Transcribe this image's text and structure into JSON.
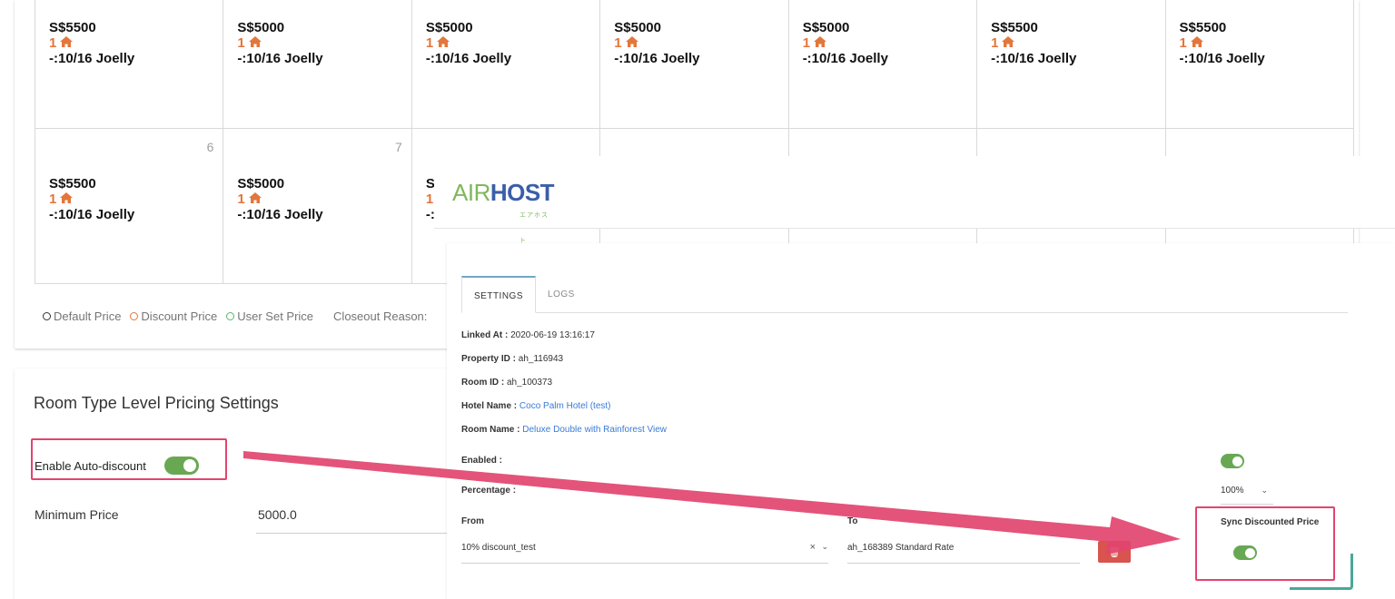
{
  "calendar": {
    "row1": [
      {
        "price": "S$5500",
        "avail": "1",
        "note": "-:10/16 Joelly"
      },
      {
        "price": "S$5000",
        "avail": "1",
        "note": "-:10/16 Joelly"
      },
      {
        "price": "S$5000",
        "avail": "1",
        "note": "-:10/16 Joelly"
      },
      {
        "price": "S$5000",
        "avail": "1",
        "note": "-:10/16 Joelly"
      },
      {
        "price": "S$5000",
        "avail": "1",
        "note": "-:10/16 Joelly"
      },
      {
        "price": "S$5500",
        "avail": "1",
        "note": "-:10/16 Joelly"
      },
      {
        "price": "S$5500",
        "avail": "1",
        "note": "-:10/16 Joelly"
      }
    ],
    "row2": [
      {
        "day": "6",
        "price": "S$5500",
        "avail": "1",
        "note": "-:10/16 Joelly"
      },
      {
        "day": "7",
        "price": "S$5000",
        "avail": "1",
        "note": "-:10/16 Joelly"
      },
      {
        "day": "",
        "price": "S:",
        "avail": "1",
        "note": "-:"
      }
    ],
    "legend": {
      "default": "Default Price",
      "discount": "Discount Price",
      "user_set": "User Set Price",
      "closeout": "Closeout Reason:"
    },
    "colors": {
      "discount": "#e3763b",
      "user_set": "#58b96a",
      "default": "#333333"
    }
  },
  "pricing": {
    "title": "Room Type Level Pricing Settings",
    "auto_discount_label": "Enable Auto-discount",
    "auto_discount_on": true,
    "min_price_label": "Minimum Price",
    "min_price_value": "5000.0"
  },
  "airhost": {
    "logo_part1": "AIR",
    "logo_part2": "HOST",
    "logo_sub": "エアホスト",
    "tabs": [
      "SETTINGS",
      "LOGS"
    ],
    "active_tab": "SETTINGS",
    "linked_at_label": "Linked At :",
    "linked_at_value": "2020-06-19 13:16:17",
    "property_id_label": "Property ID :",
    "property_id_value": "ah_116943",
    "room_id_label": "Room ID :",
    "room_id_value": "ah_100373",
    "hotel_name_label": "Hotel Name :",
    "hotel_name_value": "Coco Palm Hotel (test)",
    "room_name_label": "Room Name :",
    "room_name_value": "Deluxe Double with Rainforest View",
    "enabled_label": "Enabled :",
    "enabled_on": true,
    "percentage_label": "Percentage :",
    "percentage_value": "100%",
    "from_label": "From",
    "from_value": "10% discount_test",
    "to_label": "To",
    "to_value": "ah_168389 Standard Rate",
    "sync_label": "Sync Discounted Price",
    "sync_on": true
  },
  "annotation_color": "#e2446e"
}
